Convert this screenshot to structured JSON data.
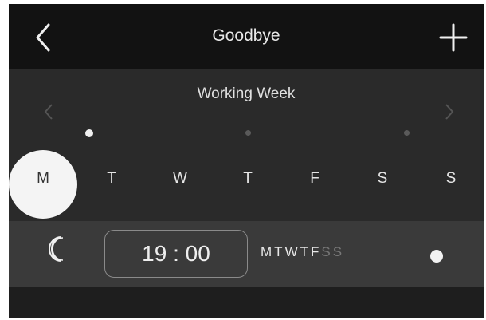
{
  "header": {
    "title": "Goodbye",
    "back_icon": "chevron-left-icon",
    "add_icon": "plus-icon"
  },
  "week": {
    "title": "Working Week",
    "prev_icon": "chevron-left-icon",
    "next_icon": "chevron-right-icon",
    "days": [
      "M",
      "T",
      "W",
      "T",
      "F",
      "S",
      "S"
    ],
    "selected_day_index": 0
  },
  "schedule": {
    "icon": "moon-icon",
    "time": "19 : 00",
    "days": [
      {
        "label": "M",
        "active": true
      },
      {
        "label": "T",
        "active": true
      },
      {
        "label": "W",
        "active": true
      },
      {
        "label": "T",
        "active": true
      },
      {
        "label": "F",
        "active": true
      },
      {
        "label": "S",
        "active": false
      },
      {
        "label": "S",
        "active": false
      }
    ],
    "enabled": true
  },
  "colors": {
    "header_bg": "#121212",
    "panel_bg": "#2a2a2a",
    "row_bg": "#3a3a3a",
    "selected_circle": "#f4f4f4"
  }
}
